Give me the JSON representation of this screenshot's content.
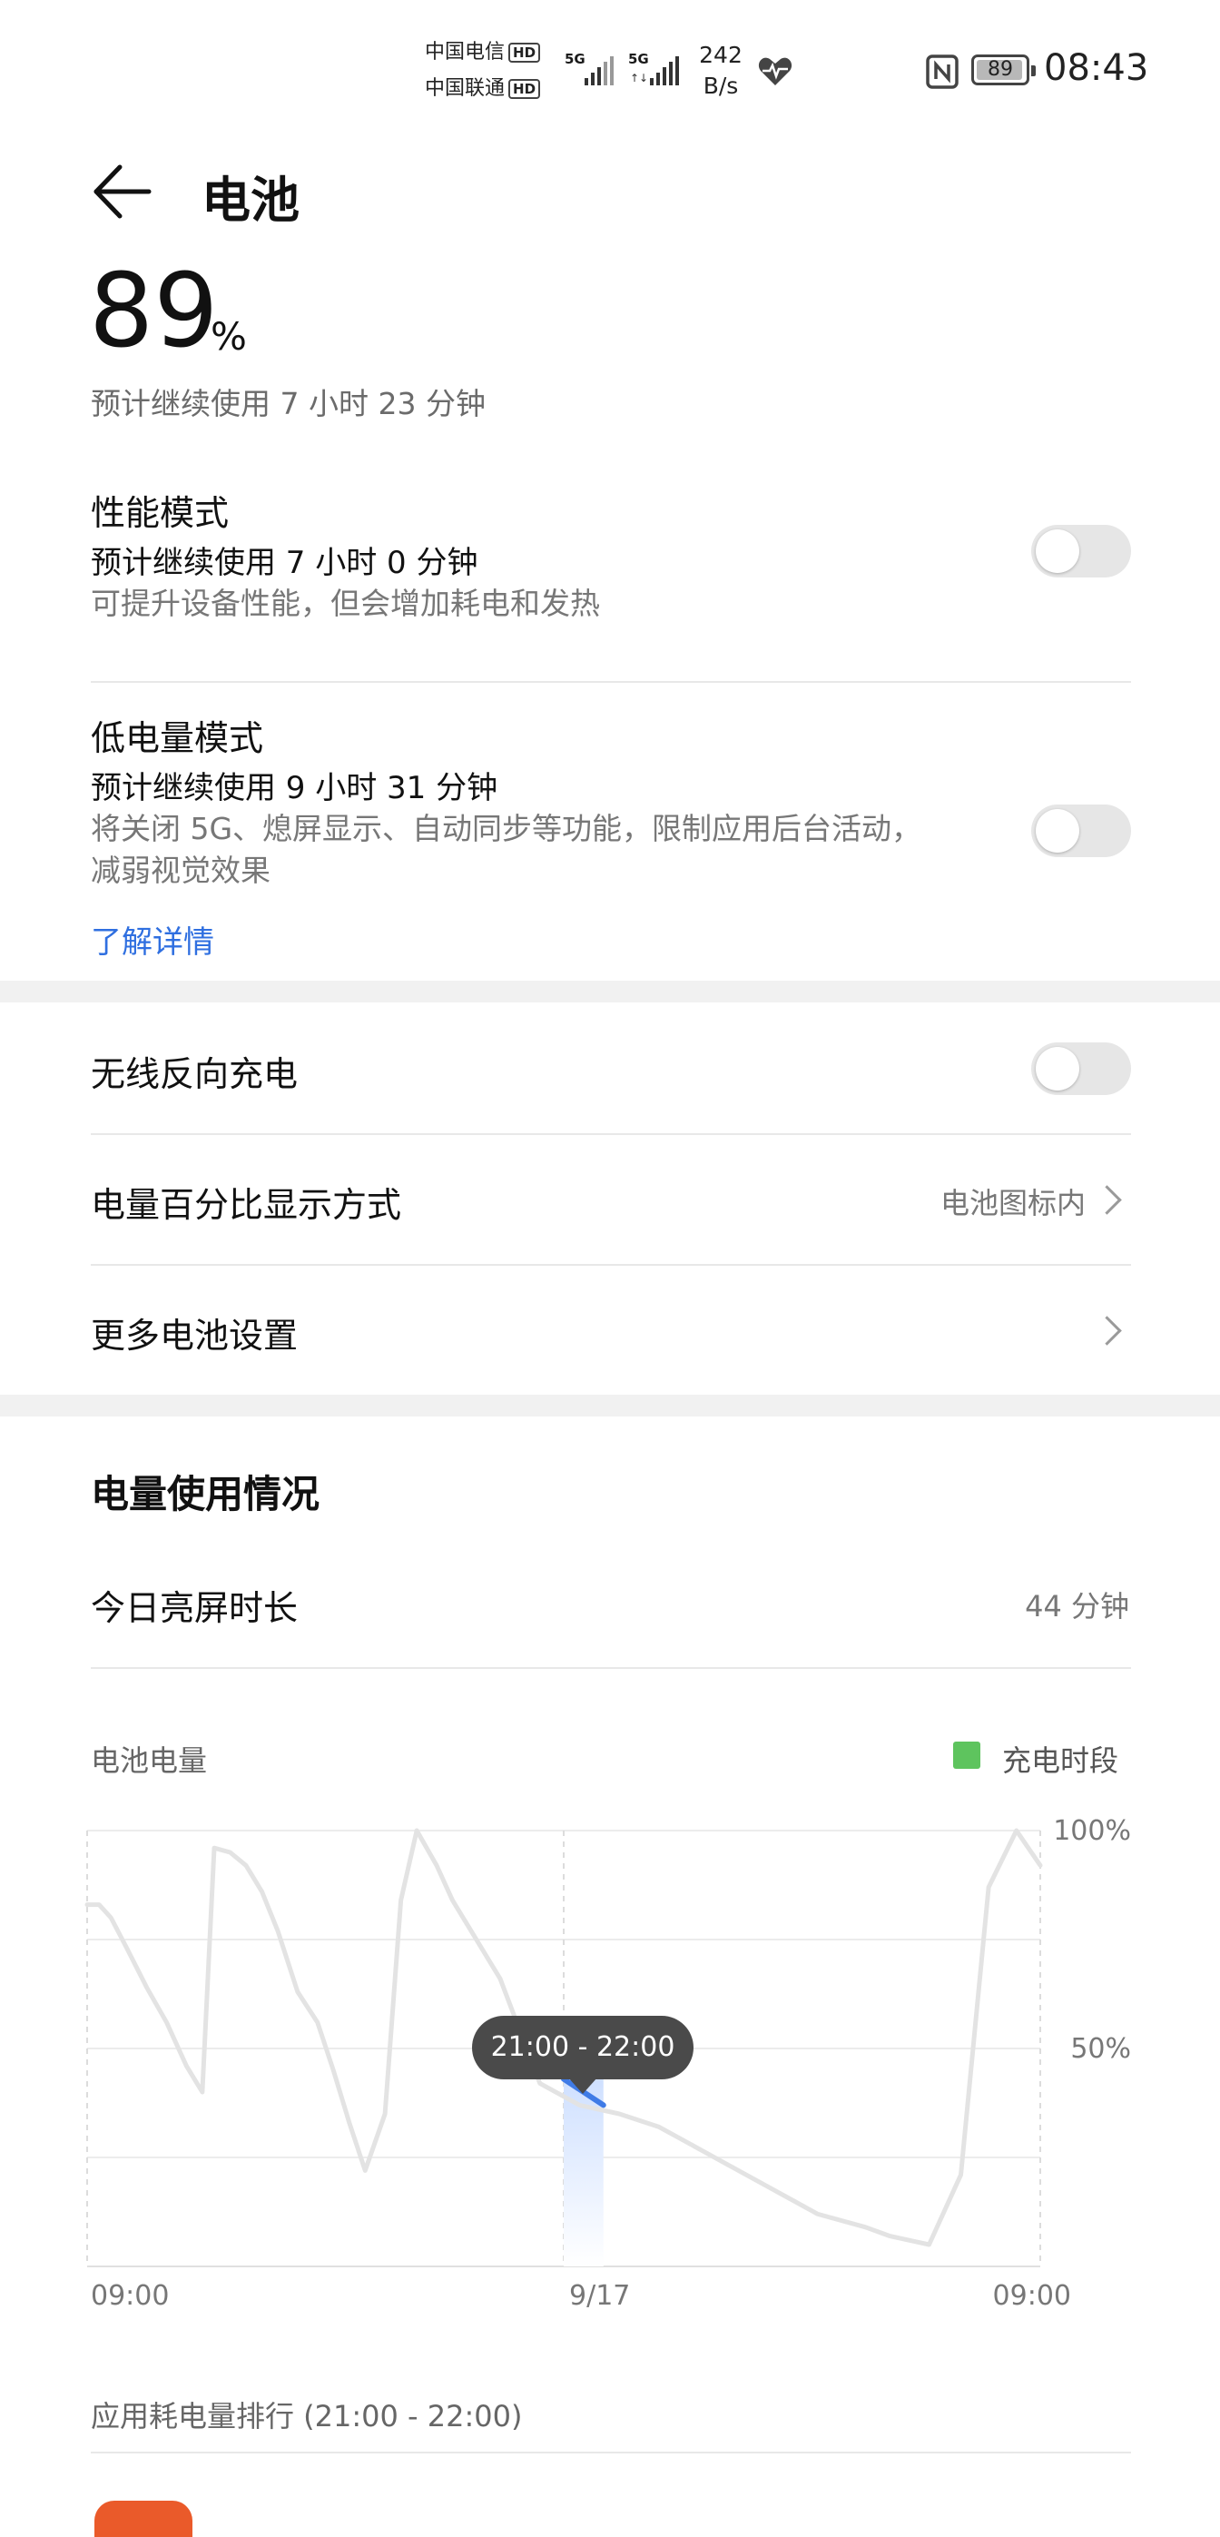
{
  "status_bar": {
    "carrier1": "中国电信",
    "carrier2": "中国联通",
    "hd": "HD",
    "net1": "5G",
    "net2": "5G",
    "speed_value": "242",
    "speed_unit": "B/s",
    "battery_level": "89",
    "time": "08:43"
  },
  "header": {
    "title": "电池"
  },
  "battery": {
    "percent": "89",
    "percent_sign": "%",
    "remaining": "预计继续使用 7 小时 23 分钟"
  },
  "performance_mode": {
    "title": "性能模式",
    "remaining": "预计继续使用 7 小时 0 分钟",
    "desc": "可提升设备性能，但会增加耗电和发热",
    "on": false
  },
  "low_power_mode": {
    "title": "低电量模式",
    "remaining": "预计继续使用 9 小时 31 分钟",
    "desc_line1": "将关闭 5G、熄屏显示、自动同步等功能，限制应用后台活动，",
    "desc_line2": "减弱视觉效果",
    "link": "了解详情",
    "on": false
  },
  "wireless_reverse": {
    "title": "无线反向充电",
    "on": false
  },
  "percent_display": {
    "title": "电量百分比显示方式",
    "value": "电池图标内"
  },
  "more_settings": {
    "title": "更多电池设置"
  },
  "usage": {
    "title": "电量使用情况",
    "screen_time_label": "今日亮屏时长",
    "screen_time_value": "44 分钟"
  },
  "chart_data": {
    "type": "line",
    "title": "电池电量",
    "legend": "充电时段",
    "legend_color": "#5ec45e",
    "line_color": "#e3e3e3",
    "highlight_color": "#3f7be6",
    "x_tick_labels": [
      "09:00",
      "9/17",
      "09:00"
    ],
    "y_tick_labels": [
      "100%",
      "50%"
    ],
    "ylim": [
      0,
      100
    ],
    "xlim": [
      0,
      24
    ],
    "series": [
      {
        "x": [
          0,
          0.3,
          0.6,
          1.0,
          1.5,
          2.0,
          2.5,
          2.9,
          3.2,
          3.6,
          4.0,
          4.4,
          4.8,
          5.3,
          5.8,
          6.2,
          6.6,
          7.0,
          7.5,
          7.9,
          8.3,
          8.8,
          9.2,
          9.6,
          10.4,
          11.4,
          12.4,
          13.4,
          14.4,
          15.4,
          16.4,
          17.4,
          18.4,
          19.6,
          20.2,
          21.2,
          22.0,
          22.7,
          23.4,
          24.0
        ],
        "y": [
          83,
          83,
          80,
          73,
          64,
          56,
          46,
          40,
          96,
          95,
          92,
          86,
          77,
          63,
          56,
          45,
          33,
          22,
          35,
          84,
          100,
          92,
          84,
          78,
          66,
          42,
          37,
          35,
          32,
          27,
          22,
          17,
          12,
          9,
          7,
          5,
          21,
          87,
          100,
          92
        ]
      }
    ],
    "highlight": {
      "label": "21:00 - 22:00",
      "x": [
        12.0,
        13.0
      ],
      "y": [
        43,
        37
      ]
    },
    "ranking_label": "应用耗电量排行 (21:00 - 22:00)"
  }
}
